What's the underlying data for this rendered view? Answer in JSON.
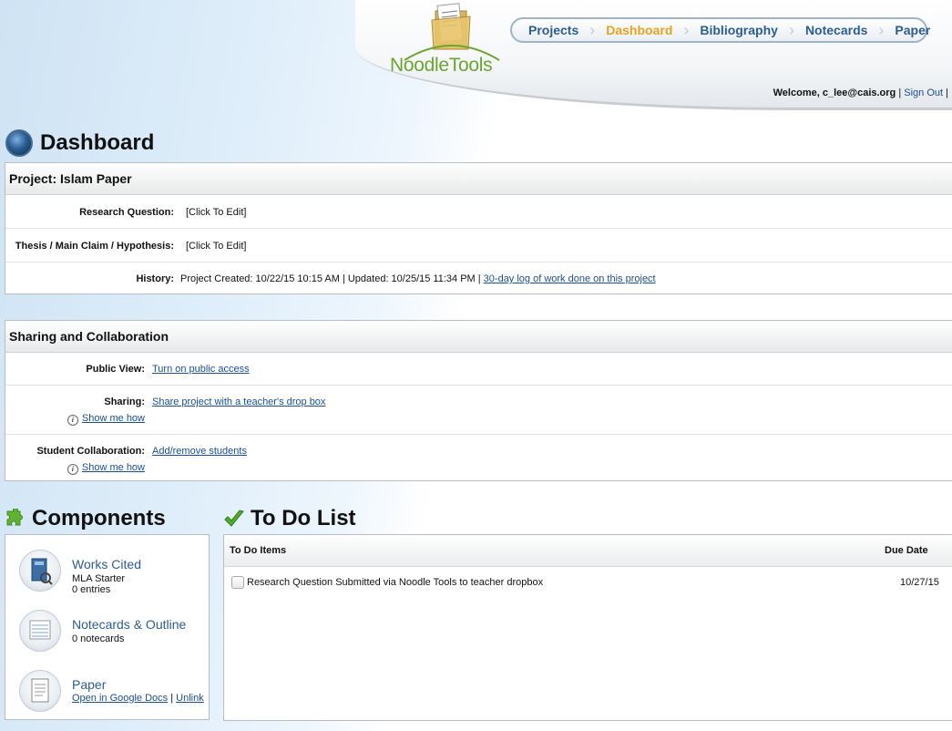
{
  "header": {
    "logo_text": "NoodleTools",
    "nav": [
      {
        "label": "Projects",
        "active": false
      },
      {
        "label": "Dashboard",
        "active": true
      },
      {
        "label": "Bibliography",
        "active": false
      },
      {
        "label": "Notecards",
        "active": false
      },
      {
        "label": "Paper",
        "active": false
      }
    ],
    "welcome_prefix": "Welcome, c_lee@cais.org",
    "sign_out": "Sign Out",
    "sep": "|"
  },
  "page_title": "Dashboard",
  "project": {
    "heading": "Project: Islam Paper",
    "research_question_label": "Research Question:",
    "research_question_value": "[Click To Edit]",
    "thesis_label": "Thesis / Main Claim / Hypothesis:",
    "thesis_value": "[Click To Edit]",
    "history_label": "History:",
    "history_text": "Project Created: 10/22/15 10:15 AM | Updated: 10/25/15 11:34 PM | ",
    "history_link": "30-day log of work done on this project"
  },
  "sharing": {
    "heading": "Sharing and Collaboration",
    "public_view_label": "Public View:",
    "public_view_link": "Turn on public access",
    "sharing_label": "Sharing:",
    "sharing_link": "Share project with a teacher's drop box",
    "show_me_how": "Show me how",
    "collab_label": "Student Collaboration:",
    "collab_link": "Add/remove students"
  },
  "components": {
    "title": "Components",
    "items": [
      {
        "name": "Works Cited",
        "sub1": "MLA Starter",
        "sub2": "0 entries"
      },
      {
        "name": "Notecards & Outline",
        "sub1": "0 notecards"
      },
      {
        "name": "Paper",
        "link1": "Open in Google Docs",
        "sep": "|",
        "link2": "Unlink"
      }
    ]
  },
  "todo": {
    "title": "To Do List",
    "col_items": "To Do Items",
    "col_due": "Due Date",
    "rows": [
      {
        "text": "Research Question Submitted via Noodle Tools to teacher dropbox",
        "due": "10/27/15"
      }
    ]
  },
  "colors": {
    "accent_active": "#e7a31f",
    "link": "#1a4f8f",
    "logo_green": "#6aa532"
  }
}
